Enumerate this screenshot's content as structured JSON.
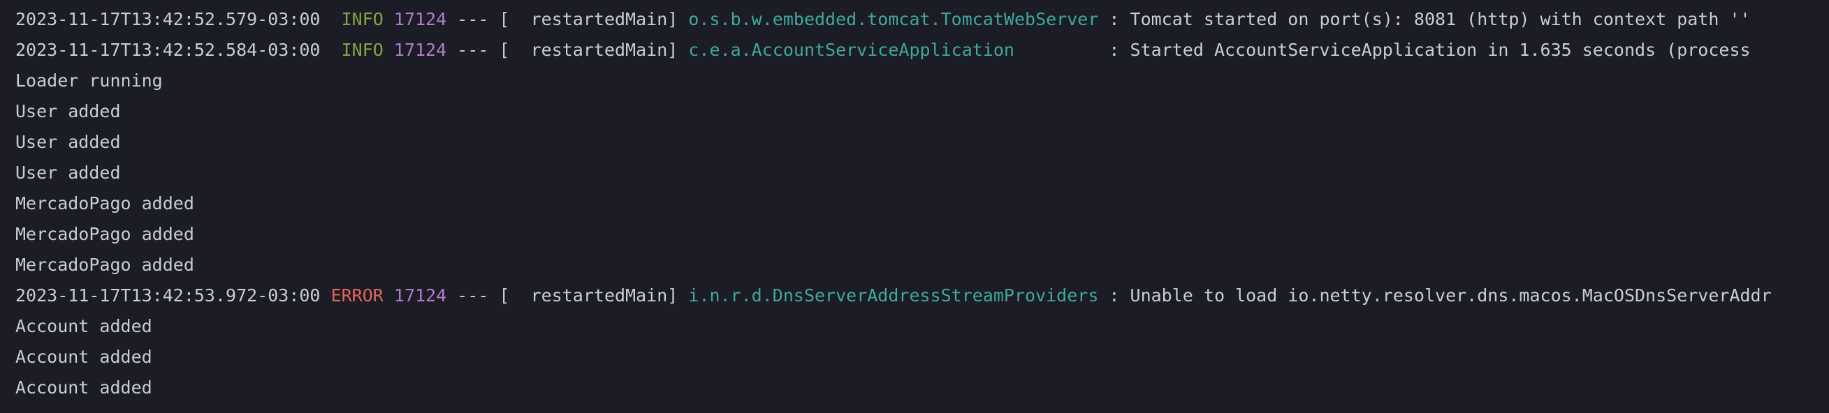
{
  "colors": {
    "background": "#1b1c25",
    "text": "#c9ccd6",
    "info": "#84a245",
    "error": "#e06558",
    "pid": "#b07ccc",
    "logger": "#3fa89b"
  },
  "console": {
    "lines": [
      {
        "timestamp": "2023-11-17T13:42:52.579-03:00",
        "level": "INFO",
        "pid": "17124",
        "separator": "--- [",
        "thread": "  restartedMain]",
        "logger": "o.s.b.w.embedded.tomcat.TomcatWebServer",
        "message": " : Tomcat started on port(s): 8081 (http) with context path ''"
      },
      {
        "timestamp": "2023-11-17T13:42:52.584-03:00",
        "level": "INFO",
        "pid": "17124",
        "separator": "--- [",
        "thread": "  restartedMain]",
        "logger": "c.e.a.AccountServiceApplication",
        "message": "         : Started AccountServiceApplication in 1.635 seconds (process"
      },
      {
        "text": "Loader running"
      },
      {
        "text": "User added"
      },
      {
        "text": "User added"
      },
      {
        "text": "User added"
      },
      {
        "text": "MercadoPago added"
      },
      {
        "text": "MercadoPago added"
      },
      {
        "text": "MercadoPago added"
      },
      {
        "timestamp": "2023-11-17T13:42:53.972-03:00",
        "level": "ERROR",
        "pid": "17124",
        "separator": "--- [",
        "thread": "  restartedMain]",
        "logger": "i.n.r.d.DnsServerAddressStreamProviders",
        "message": " : Unable to load io.netty.resolver.dns.macos.MacOSDnsServerAddr"
      },
      {
        "text": "Account added"
      },
      {
        "text": "Account added"
      },
      {
        "text": "Account added"
      }
    ]
  }
}
